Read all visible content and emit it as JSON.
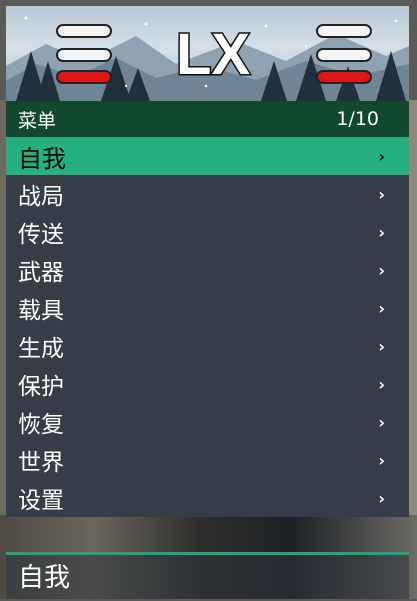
{
  "header": {
    "logo_text": "LX",
    "colors": {
      "white_bar": "#f4f4f4",
      "red_bar": "#e01515",
      "banner_sky": "#c9d5df"
    }
  },
  "titlebar": {
    "title": "菜单",
    "counter": "1/10"
  },
  "menu": {
    "colors": {
      "selected": "#26b07f",
      "background": "#363d48",
      "titlebar": "#11492f"
    },
    "items": [
      {
        "label": "自我",
        "selected": true,
        "icon": "chevron-right-icon"
      },
      {
        "label": "战局",
        "icon": "chevron-right-icon"
      },
      {
        "label": "传送",
        "icon": "chevron-right-icon"
      },
      {
        "label": "武器",
        "icon": "chevron-right-icon"
      },
      {
        "label": "载具",
        "icon": "chevron-right-icon"
      },
      {
        "label": "生成",
        "icon": "chevron-right-icon"
      },
      {
        "label": "保护",
        "icon": "chevron-right-icon"
      },
      {
        "label": "恢复",
        "icon": "chevron-right-icon"
      },
      {
        "label": "世界",
        "icon": "chevron-right-icon"
      },
      {
        "label": "设置",
        "icon": "chevron-right-icon"
      }
    ],
    "chevron_glyph": "›"
  },
  "footer": {
    "description": "自我"
  }
}
